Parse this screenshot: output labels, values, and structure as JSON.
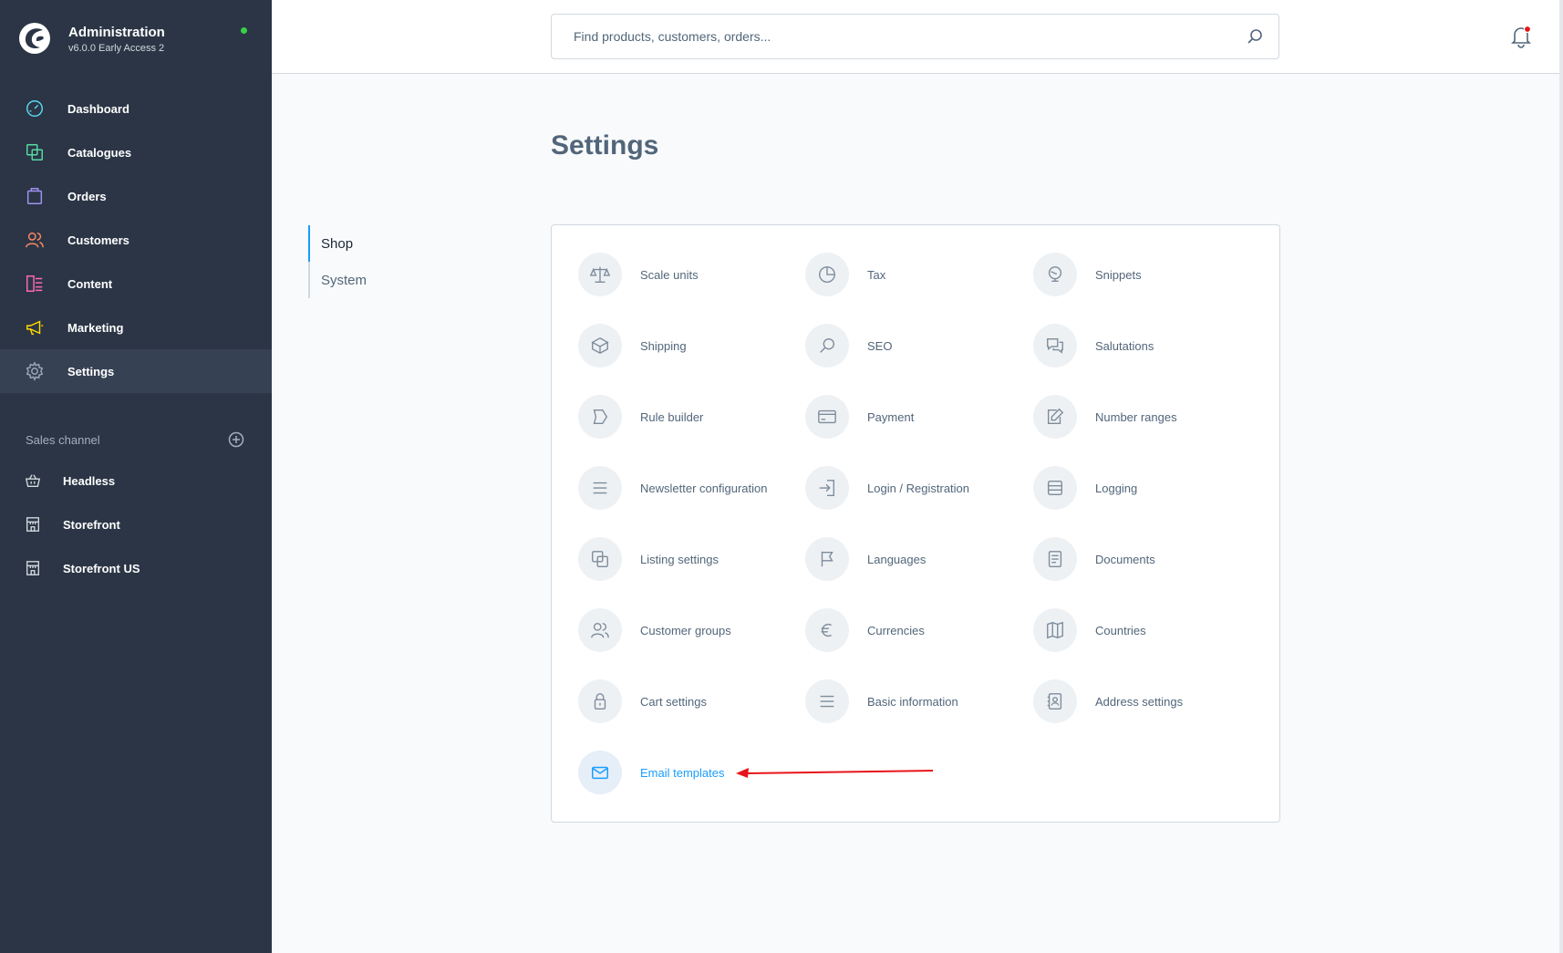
{
  "brand": {
    "title": "Administration",
    "version": "v6.0.0 Early Access 2",
    "status_color": "#37d046"
  },
  "nav": [
    {
      "label": "Dashboard",
      "icon": "dashboard-icon",
      "color": "#57d9f0"
    },
    {
      "label": "Catalogues",
      "icon": "catalogue-icon",
      "color": "#57d9a3"
    },
    {
      "label": "Orders",
      "icon": "orders-icon",
      "color": "#a092f0"
    },
    {
      "label": "Customers",
      "icon": "customers-icon",
      "color": "#f88962"
    },
    {
      "label": "Content",
      "icon": "content-icon",
      "color": "#ff68b4"
    },
    {
      "label": "Marketing",
      "icon": "marketing-icon",
      "color": "#ffd700"
    },
    {
      "label": "Settings",
      "icon": "settings-icon",
      "color": "#9aa8b5",
      "active": true
    }
  ],
  "sales_channel": {
    "title": "Sales channel",
    "items": [
      {
        "label": "Headless",
        "icon": "basket-icon"
      },
      {
        "label": "Storefront",
        "icon": "storefront-icon"
      },
      {
        "label": "Storefront US",
        "icon": "storefront-icon"
      }
    ]
  },
  "search": {
    "placeholder": "Find products, customers, orders..."
  },
  "page": {
    "title": "Settings"
  },
  "tabs": [
    {
      "label": "Shop",
      "active": true
    },
    {
      "label": "System",
      "active": false
    }
  ],
  "settings_items": [
    {
      "label": "Scale units",
      "icon": "scale-icon"
    },
    {
      "label": "Tax",
      "icon": "pie-chart-icon"
    },
    {
      "label": "Snippets",
      "icon": "globe-icon"
    },
    {
      "label": "Shipping",
      "icon": "package-icon"
    },
    {
      "label": "SEO",
      "icon": "search-icon"
    },
    {
      "label": "Salutations",
      "icon": "chat-icon"
    },
    {
      "label": "Rule builder",
      "icon": "tag-icon"
    },
    {
      "label": "Payment",
      "icon": "credit-card-icon"
    },
    {
      "label": "Number ranges",
      "icon": "edit-icon"
    },
    {
      "label": "Newsletter configuration",
      "icon": "list-icon"
    },
    {
      "label": "Login / Registration",
      "icon": "sign-in-icon"
    },
    {
      "label": "Logging",
      "icon": "database-icon"
    },
    {
      "label": "Listing settings",
      "icon": "copy-icon"
    },
    {
      "label": "Languages",
      "icon": "flag-icon"
    },
    {
      "label": "Documents",
      "icon": "document-icon"
    },
    {
      "label": "Customer groups",
      "icon": "users-icon"
    },
    {
      "label": "Currencies",
      "icon": "euro-icon"
    },
    {
      "label": "Countries",
      "icon": "map-icon"
    },
    {
      "label": "Cart settings",
      "icon": "lock-icon"
    },
    {
      "label": "Basic information",
      "icon": "list-icon"
    },
    {
      "label": "Address settings",
      "icon": "address-book-icon"
    },
    {
      "label": "Email templates",
      "icon": "envelope-icon",
      "highlight": true
    }
  ],
  "colors": {
    "accent": "#189eff",
    "sidebar": "#2b3545",
    "annotation_arrow": "#e8141b"
  }
}
